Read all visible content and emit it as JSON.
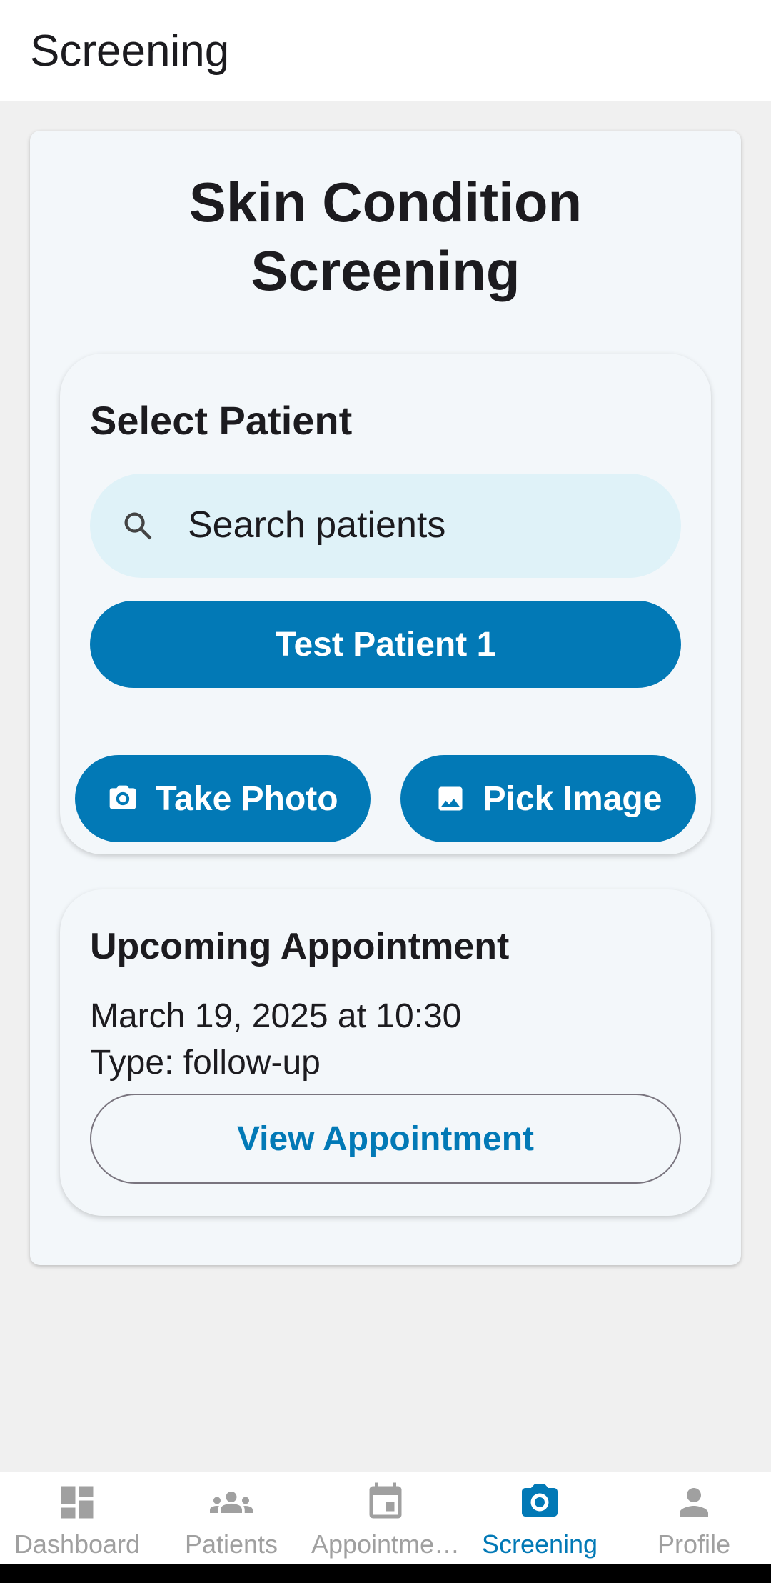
{
  "app_bar": {
    "title": "Screening"
  },
  "screen": {
    "title": "Skin Condition Screening"
  },
  "patient_card": {
    "heading": "Select Patient",
    "search_placeholder": "Search patients",
    "selected_patient": "Test Patient 1"
  },
  "actions": {
    "take_photo": {
      "label": "Take Photo",
      "icon": "camera-icon"
    },
    "pick_image": {
      "label": "Pick Image",
      "icon": "image-icon"
    }
  },
  "appointment_card": {
    "heading": "Upcoming Appointment",
    "date": "March 19, 2025 at 10:30",
    "type": "Type: follow-up",
    "button": "View Appointment"
  },
  "bottom_nav": {
    "items": [
      {
        "label": "Dashboard",
        "icon": "dashboard-icon",
        "active": false
      },
      {
        "label": "Patients",
        "icon": "people-icon",
        "active": false
      },
      {
        "label": "Appointme…",
        "icon": "calendar-icon",
        "active": false
      },
      {
        "label": "Screening",
        "icon": "camera-icon",
        "active": true
      },
      {
        "label": "Profile",
        "icon": "person-icon",
        "active": false
      }
    ]
  },
  "colors": {
    "primary": "#0279b6",
    "search_fill": "#dff2f8",
    "card_bg": "#f3f7fa",
    "inactive_nav": "#a0a0a0"
  }
}
